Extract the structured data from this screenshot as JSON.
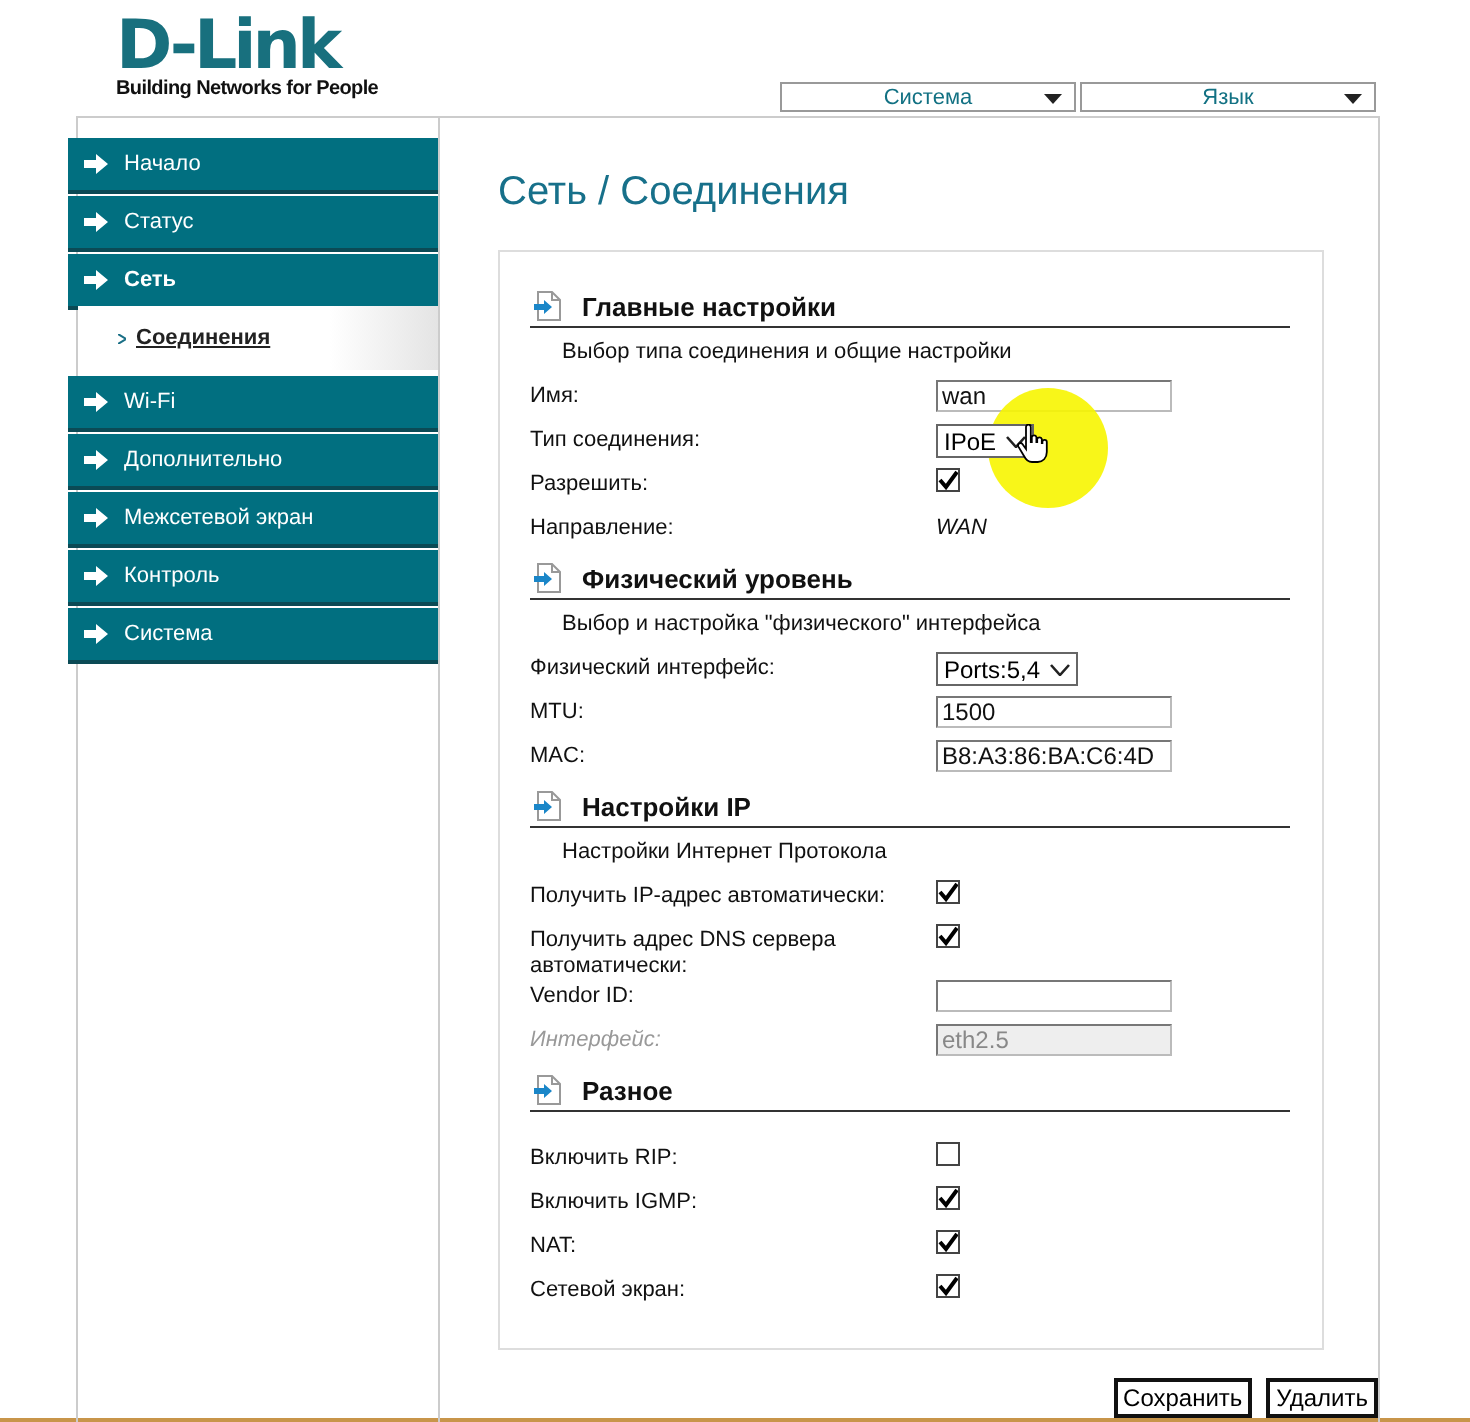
{
  "logo": {
    "name": "D-Link",
    "tagline": "Building Networks for People"
  },
  "top_menu": [
    {
      "label": "Система"
    },
    {
      "label": "Язык"
    }
  ],
  "sidebar": {
    "items": [
      {
        "label": "Начало",
        "expanded": false
      },
      {
        "label": "Статус",
        "expanded": false
      },
      {
        "label": "Сеть",
        "expanded": true,
        "children": [
          {
            "label": "Соединения",
            "selected": true
          }
        ]
      },
      {
        "label": "Wi-Fi",
        "expanded": false
      },
      {
        "label": "Дополнительно",
        "expanded": false
      },
      {
        "label": "Межсетевой экран",
        "expanded": false
      },
      {
        "label": "Контроль",
        "expanded": false
      },
      {
        "label": "Система",
        "expanded": false
      }
    ]
  },
  "page_title": "Сеть  / Соединения",
  "sections": [
    {
      "title": "Главные настройки",
      "subtitle": "Выбор типа соединения и общие настройки",
      "rows": [
        {
          "kind": "text-input",
          "label": "Имя:",
          "value": "wan",
          "disabled": false
        },
        {
          "kind": "select",
          "label": "Тип соединения:",
          "value": "IPoE"
        },
        {
          "kind": "checkbox",
          "label": "Разрешить:",
          "checked": true
        },
        {
          "kind": "static",
          "label": "Направление:",
          "value": "WAN"
        }
      ]
    },
    {
      "title": "Физический уровень",
      "subtitle": "Выбор и настройка \"физического\" интерфейса",
      "rows": [
        {
          "kind": "select",
          "label": "Физический интерфейс:",
          "value": "Ports:5,4"
        },
        {
          "kind": "text-input",
          "label": "MTU:",
          "value": "1500",
          "disabled": false
        },
        {
          "kind": "text-input",
          "label": "MAC:",
          "value": "B8:A3:86:BA:C6:4D",
          "disabled": false
        }
      ]
    },
    {
      "title": "Настройки IP",
      "subtitle": "Настройки Интернет Протокола",
      "rows": [
        {
          "kind": "checkbox",
          "label": "Получить IP-адрес автоматически:",
          "checked": true
        },
        {
          "kind": "checkbox",
          "label": "Получить адрес DNS сервера автоматически:",
          "checked": true
        },
        {
          "kind": "text-input",
          "label": "Vendor ID:",
          "value": "",
          "disabled": false
        },
        {
          "kind": "text-input",
          "label": "Интерфейс:",
          "value": "eth2.5",
          "disabled": true
        }
      ]
    },
    {
      "title": "Разное",
      "rows": [
        {
          "kind": "checkbox",
          "label": "Включить RIP:",
          "checked": false
        },
        {
          "kind": "checkbox",
          "label": "Включить IGMP:",
          "checked": true
        },
        {
          "kind": "checkbox",
          "label": "NAT:",
          "checked": true
        },
        {
          "kind": "checkbox",
          "label": "Сетевой экран:",
          "checked": true
        }
      ]
    }
  ],
  "buttons": [
    {
      "label": "Сохранить"
    },
    {
      "label": "Удалить"
    }
  ]
}
